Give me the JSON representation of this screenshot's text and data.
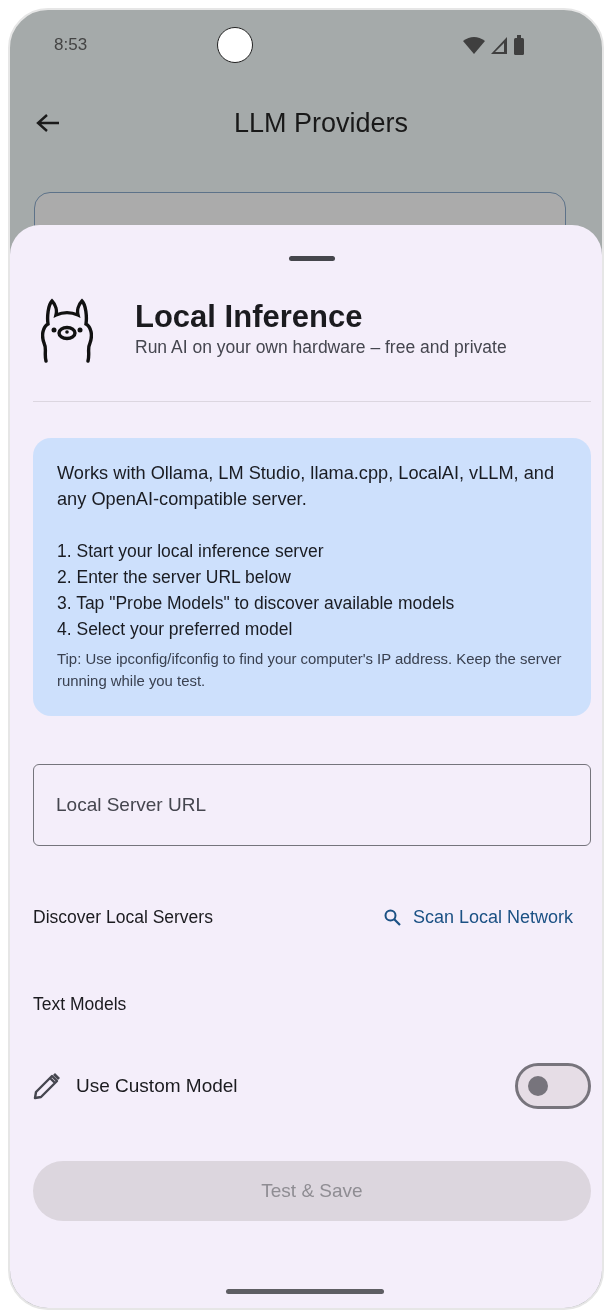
{
  "status_bar": {
    "time": "8:53"
  },
  "app_bar": {
    "title": "LLM Providers"
  },
  "sheet": {
    "title": "Local Inference",
    "subtitle": "Run AI on your own hardware – free and private",
    "info": {
      "intro": "Works with Ollama, LM Studio, llama.cpp, LocalAI, vLLM, and any OpenAI-compatible server.",
      "steps": [
        "1. Start your local inference server",
        "2. Enter the server URL below",
        "3. Tap \"Probe Models\" to discover available models",
        "4. Select your preferred model"
      ],
      "tip": "Tip: Use ipconfig/ifconfig to find your computer's IP address. Keep the server running while you test."
    },
    "url_field": {
      "placeholder": "Local Server URL"
    },
    "discover": {
      "label": "Discover Local Servers",
      "action": "Scan Local Network"
    },
    "section_title": "Text Models",
    "custom_model": {
      "label": "Use Custom Model",
      "on": false
    },
    "primary_button": {
      "label": "Test & Save",
      "disabled": true
    }
  }
}
